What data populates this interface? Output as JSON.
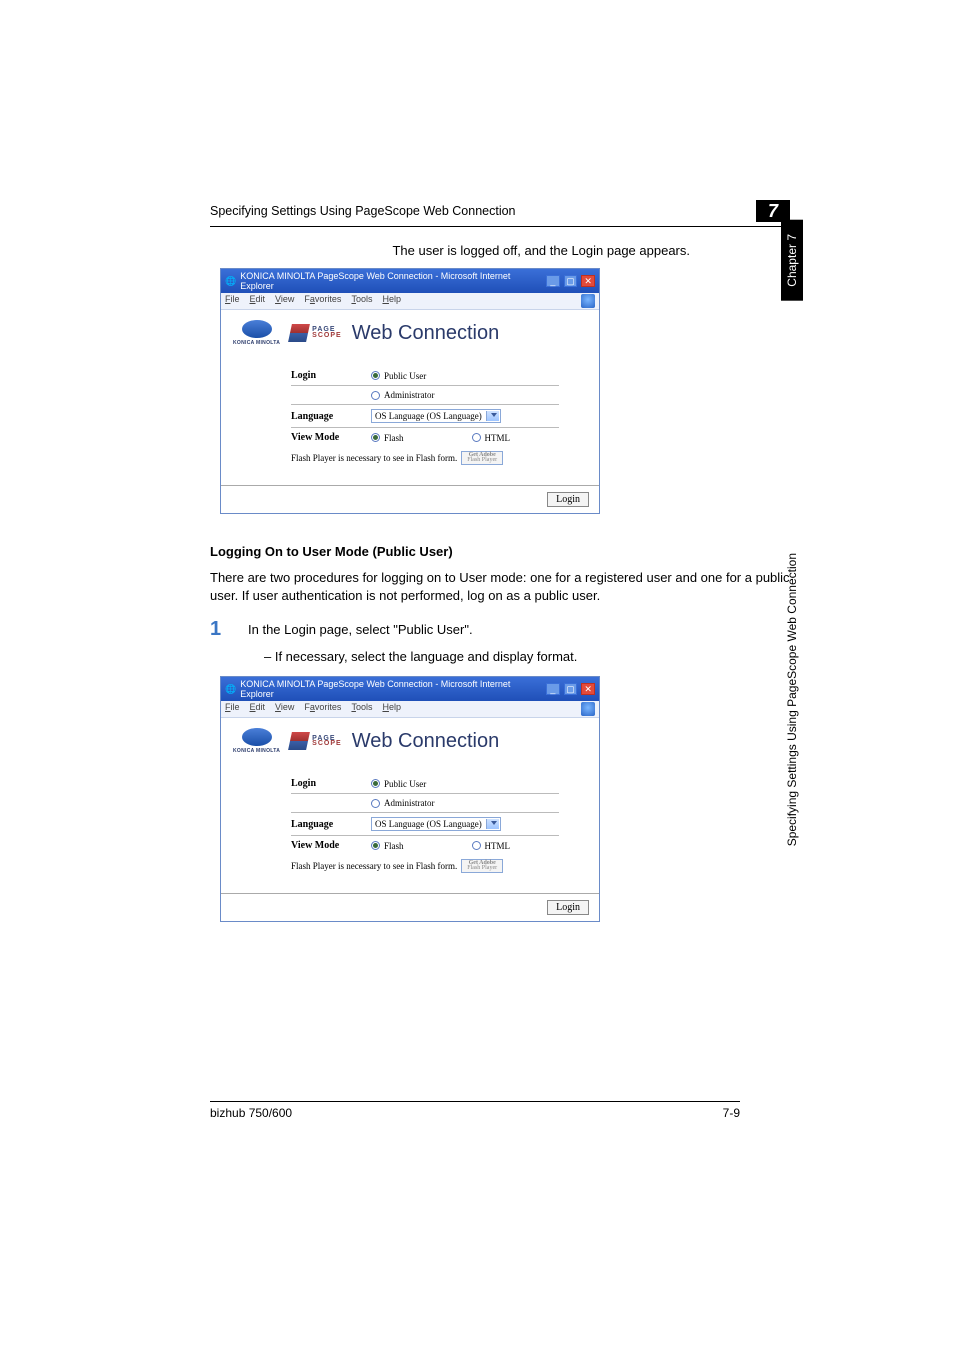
{
  "header": {
    "title": "Specifying Settings Using PageScope Web Connection",
    "chapter_number": "7"
  },
  "side": {
    "chapter": "Chapter 7",
    "text": "Specifying Settings Using PageScope Web Connection"
  },
  "body": {
    "logout_result": "The user is logged off, and the Login page appears.",
    "subheading": "Logging On to User Mode (Public User)",
    "paragraph": "There are two procedures for logging on to User mode: one for a registered user and one for a public user. If user authentication is not performed, log on as a public user.",
    "step1_num": "1",
    "step1_text": "In the Login page, select \"Public User\".",
    "step1_sub": "–   If necessary, select the language and display format."
  },
  "ie": {
    "title": "KONICA MINOLTA PageScope Web Connection - Microsoft Internet Explorer",
    "menu": [
      "File",
      "Edit",
      "View",
      "Favorites",
      "Tools",
      "Help"
    ],
    "brand_small": "KONICA MINOLTA",
    "ps1": "PAGE",
    "ps2": "SCOPE",
    "banner_text": "Web Connection",
    "login_label": "Login",
    "public_user": "Public User",
    "administrator": "Administrator",
    "language_label": "Language",
    "language_value": "OS Language (OS Language)",
    "viewmode_label": "View Mode",
    "flash": "Flash",
    "html": "HTML",
    "flash_note": "Flash Player is necessary to see in Flash form.",
    "flash_badge1": "Get Adobe",
    "flash_badge2": "Flash Player",
    "login_btn": "Login"
  },
  "footer": {
    "product": "bizhub 750/600",
    "page": "7-9"
  }
}
